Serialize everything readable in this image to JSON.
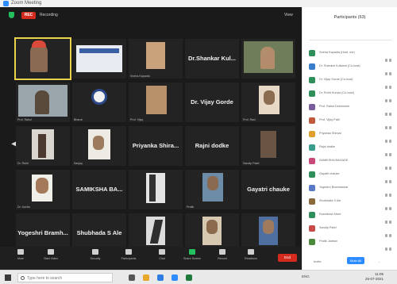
{
  "window": {
    "title": "Zoom Meeting"
  },
  "topbar": {
    "recording_badge": "REC",
    "recording_text": "Recording",
    "view_label": "View"
  },
  "tiles": [
    {
      "name": "",
      "active": true
    },
    {
      "name": ""
    },
    {
      "name": "Sneha Kapadia"
    },
    {
      "name": "Dr.Shankar Kul..."
    },
    {
      "name": ""
    },
    {
      "name": "Prof. Rahul"
    },
    {
      "name": "Bharat"
    },
    {
      "name": "Prof. Vijay"
    },
    {
      "name": "Dr. Vijay Gorde"
    },
    {
      "name": "Prof. Ravi"
    },
    {
      "name": "Dr. Rohit"
    },
    {
      "name": "Sanjay"
    },
    {
      "name": "Priyanka Shira..."
    },
    {
      "name": "Rajni dodke"
    },
    {
      "name": "Sandip Patel"
    },
    {
      "name": "Dr. Kavita"
    },
    {
      "name": "SAMIKSHA BA..."
    },
    {
      "name": ""
    },
    {
      "name": "Pratik"
    },
    {
      "name": "Gayatri chauke"
    },
    {
      "name": "Yogeshri Bramh..."
    },
    {
      "name": "Shubhada S Ale"
    },
    {
      "name": "Prof. Sandeep"
    },
    {
      "name": "Rushikesh"
    },
    {
      "name": "Rushita"
    }
  ],
  "toolbar": {
    "items": [
      "Mute",
      "Start Video",
      "Security",
      "Participants",
      "Chat",
      "Share Screen",
      "Record",
      "Reactions"
    ],
    "end_label": "End"
  },
  "participants": {
    "title": "Participants (63)",
    "list": [
      "Sneha Kapadia (Host, me)",
      "Dr. Shankar Kulkarni (Co-host)",
      "Dr. Vijay Gorde (Co-host)",
      "Dr. Rohit Kumar (Co-host)",
      "Prof. Rahul Deshmukh",
      "Prof. Vijay Patil",
      "Priyanka Shirsat",
      "Rajni dodke",
      "SAMIKSHA BAGADE",
      "Gayatri chauke",
      "Yogeshri Bramhankar",
      "Shubhada S Ale",
      "Rushikesh More",
      "Sandip Patel",
      "Pratik Jadhav"
    ],
    "invite_label": "Invite",
    "mute_all_label": "Mute All",
    "more_label": "..."
  },
  "taskbar": {
    "search_placeholder": "Type here to search",
    "tray_text": "ENG",
    "time": "11:05",
    "date": "25-07-2021"
  },
  "colors": {
    "accent": "#2d8cff",
    "danger": "#d52b1e",
    "active_speaker": "#e8d34a",
    "secure": "#25c05e"
  }
}
